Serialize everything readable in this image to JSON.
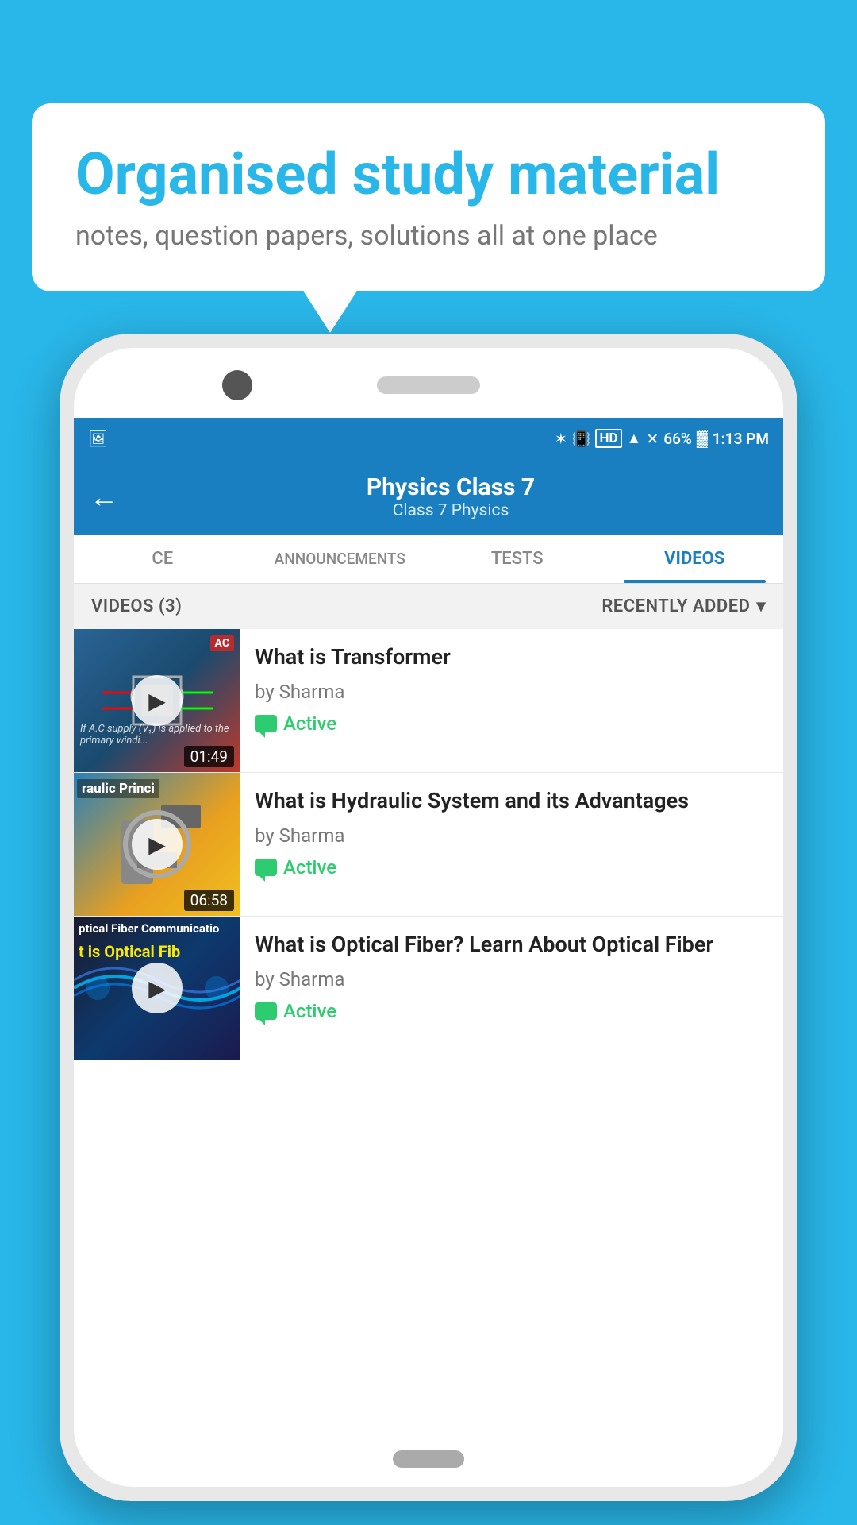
{
  "background_color": "#29b6e8",
  "bubble": {
    "title": "Organised study material",
    "subtitle": "notes, question papers, solutions all at one place"
  },
  "status_bar": {
    "time": "1:13 PM",
    "battery": "66%",
    "signal_icons": "🔵 📳 HD ▲ ✕",
    "battery_icon": "🔋"
  },
  "header": {
    "title": "Physics Class 7",
    "breadcrumb": "Class 7    Physics",
    "back_label": "←"
  },
  "tabs": [
    {
      "id": "ce",
      "label": "CE",
      "active": false
    },
    {
      "id": "announcements",
      "label": "ANNOUNCEMENTS",
      "active": false
    },
    {
      "id": "tests",
      "label": "TESTS",
      "active": false
    },
    {
      "id": "videos",
      "label": "VIDEOS",
      "active": true
    }
  ],
  "videos_section": {
    "count_label": "VIDEOS (3)",
    "sort_label": "RECENTLY ADDED",
    "videos": [
      {
        "id": 1,
        "title": "What is  Transformer",
        "author": "by Sharma",
        "status": "Active",
        "duration": "01:49",
        "thumb_type": "transformer",
        "thumb_overlay_text": "If A.C supply (V₁) is applied to the primary windi..."
      },
      {
        "id": 2,
        "title": "What is Hydraulic System and its Advantages",
        "author": "by Sharma",
        "status": "Active",
        "duration": "06:58",
        "thumb_type": "hydraulic",
        "thumb_top_label": "raulic Princi"
      },
      {
        "id": 3,
        "title": "What is Optical Fiber? Learn About Optical Fiber",
        "author": "by Sharma",
        "status": "Active",
        "duration": "",
        "thumb_type": "optical",
        "thumb_top_label": "ptical Fiber Communicatio",
        "thumb_second_label": "t is Optical Fib"
      }
    ]
  }
}
